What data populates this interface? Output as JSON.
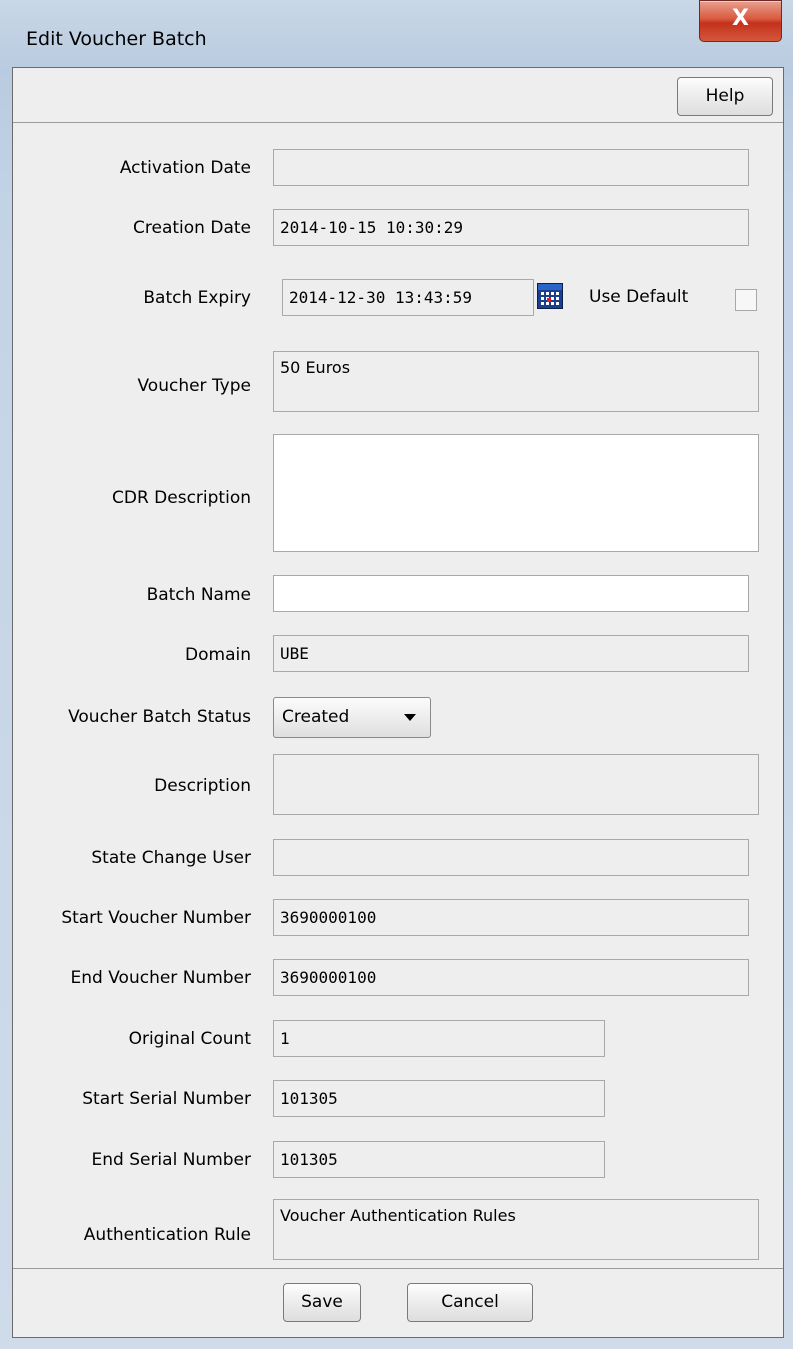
{
  "window": {
    "title": "Edit Voucher Batch",
    "close_glyph": "X"
  },
  "toolbar": {
    "help_label": "Help"
  },
  "form": {
    "activation_date": {
      "label": "Activation Date",
      "value": ""
    },
    "creation_date": {
      "label": "Creation Date",
      "value": "2014-10-15 10:30:29"
    },
    "batch_expiry": {
      "label": "Batch Expiry",
      "value": "2014-12-30 13:43:59",
      "use_default_label": "Use Default",
      "use_default_checked": false
    },
    "voucher_type": {
      "label": "Voucher Type",
      "value": "50 Euros"
    },
    "cdr_description": {
      "label": "CDR Description",
      "value": ""
    },
    "batch_name": {
      "label": "Batch Name",
      "value": ""
    },
    "domain": {
      "label": "Domain",
      "value": "UBE"
    },
    "voucher_batch_status": {
      "label": "Voucher Batch Status",
      "value": "Created"
    },
    "description": {
      "label": "Description",
      "value": ""
    },
    "state_change_user": {
      "label": "State Change User",
      "value": ""
    },
    "start_voucher_number": {
      "label": "Start Voucher Number",
      "value": "3690000100"
    },
    "end_voucher_number": {
      "label": "End Voucher Number",
      "value": "3690000100"
    },
    "original_count": {
      "label": "Original Count",
      "value": "1"
    },
    "start_serial_number": {
      "label": "Start Serial Number",
      "value": "101305"
    },
    "end_serial_number": {
      "label": "End Serial Number",
      "value": "101305"
    },
    "authentication_rule": {
      "label": "Authentication Rule",
      "value": "Voucher Authentication Rules"
    }
  },
  "footer": {
    "save_label": "Save",
    "cancel_label": "Cancel"
  }
}
